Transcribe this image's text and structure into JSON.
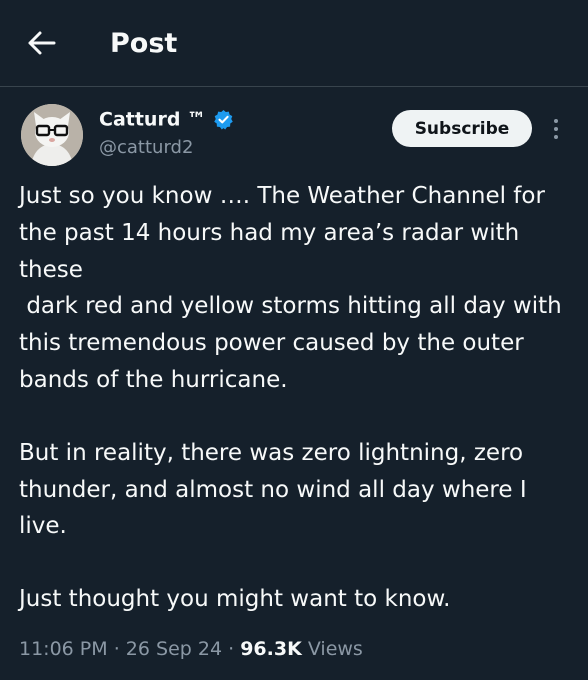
{
  "header": {
    "title": "Post"
  },
  "author": {
    "name": "Catturd ™",
    "handle": "@catturd2",
    "verified": true
  },
  "actions": {
    "subscribe_label": "Subscribe"
  },
  "post": {
    "paragraphs": [
      "Just so you know …. The Weather Channel for the past 14 hours had my area’s radar with these\n dark red and yellow storms hitting all day with this tremendous power caused by the outer bands of the hurricane.",
      "But in reality, there was zero lightning, zero thunder, and almost no wind all day where I live.",
      "Just thought you might want to know."
    ]
  },
  "meta": {
    "time": "11:06 PM",
    "date": "26 Sep 24",
    "views_count": "96.3K",
    "views_label": "Views",
    "separator": "·"
  },
  "colors": {
    "background": "#15202b",
    "text": "#f7f9f9",
    "muted": "#8b98a5",
    "verified": "#1d9bf0",
    "divider": "#38444d"
  },
  "icons": [
    "back-arrow-icon",
    "verified-badge-icon",
    "more-options-icon"
  ]
}
